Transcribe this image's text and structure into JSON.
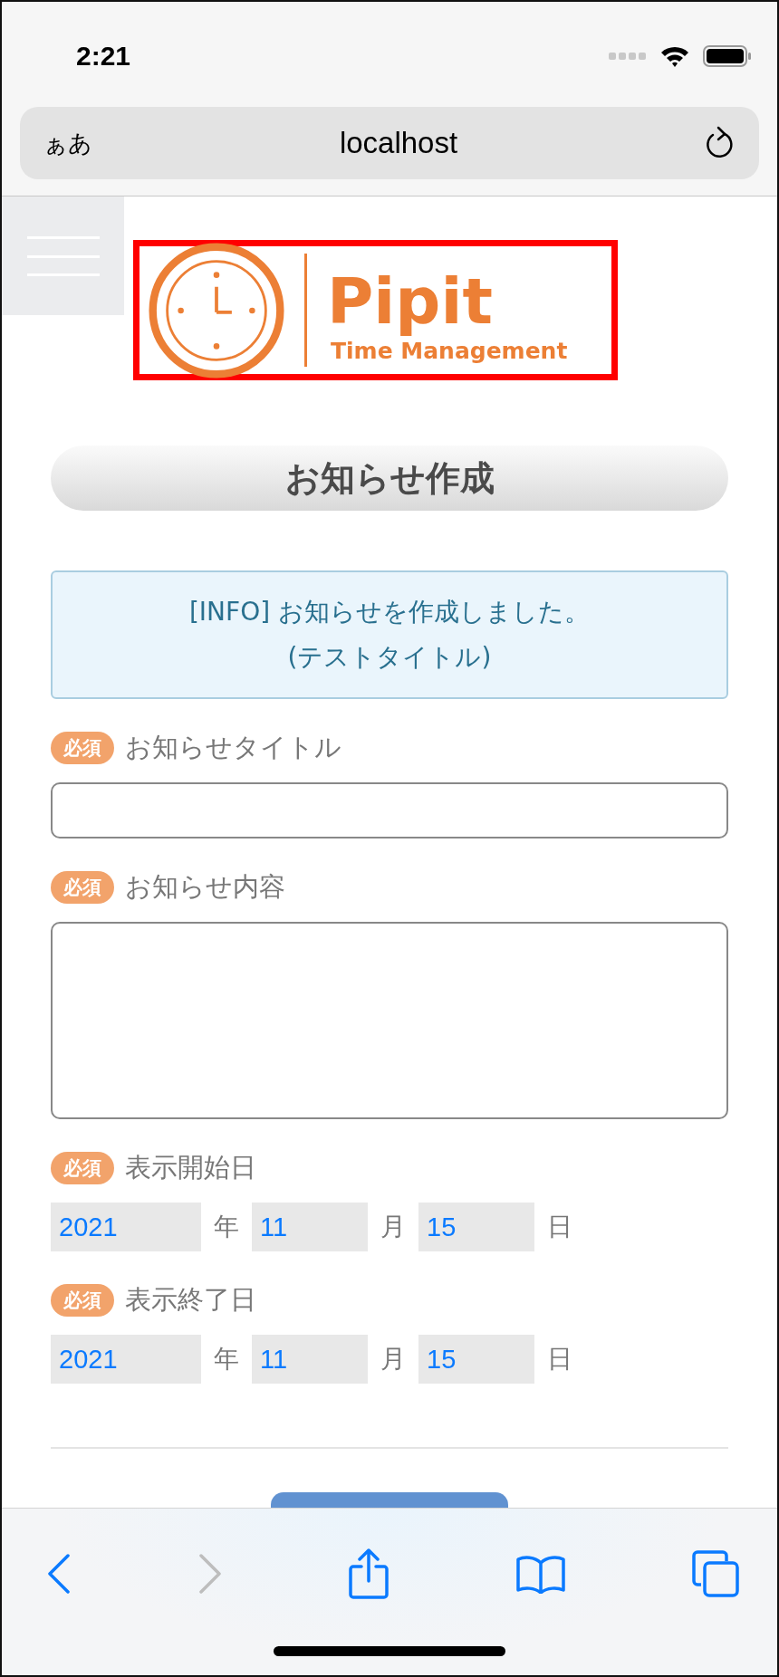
{
  "status_bar": {
    "time": "2:21"
  },
  "address_bar": {
    "text_size_button": "ぁあ",
    "url": "localhost"
  },
  "logo": {
    "name": "Pipit",
    "tagline": "Time Management"
  },
  "page_title": "お知らせ作成",
  "message": {
    "lines": [
      "[INFO] お知らせを作成しました。",
      "(テストタイトル)"
    ]
  },
  "fields": [
    {
      "kind": "text",
      "badge": "必須",
      "label": "お知らせタイトル"
    },
    {
      "kind": "textarea",
      "badge": "必須",
      "label": "お知らせ内容"
    },
    {
      "kind": "date",
      "badge": "必須",
      "label": "表示開始日",
      "parts": [
        {
          "value": "2021",
          "unit": "年"
        },
        {
          "value": "11",
          "unit": "月"
        },
        {
          "value": "15",
          "unit": "日"
        }
      ]
    },
    {
      "kind": "date",
      "badge": "必須",
      "label": "表示終了日",
      "parts": [
        {
          "value": "2021",
          "unit": "年"
        },
        {
          "value": "11",
          "unit": "月"
        },
        {
          "value": "15",
          "unit": "日"
        }
      ]
    }
  ],
  "toolbar": [
    {
      "kind": "back",
      "disabled": false
    },
    {
      "kind": "forward",
      "disabled": true
    },
    {
      "kind": "share",
      "disabled": false
    },
    {
      "kind": "bookmarks",
      "disabled": false
    },
    {
      "kind": "tabs",
      "disabled": false
    }
  ]
}
